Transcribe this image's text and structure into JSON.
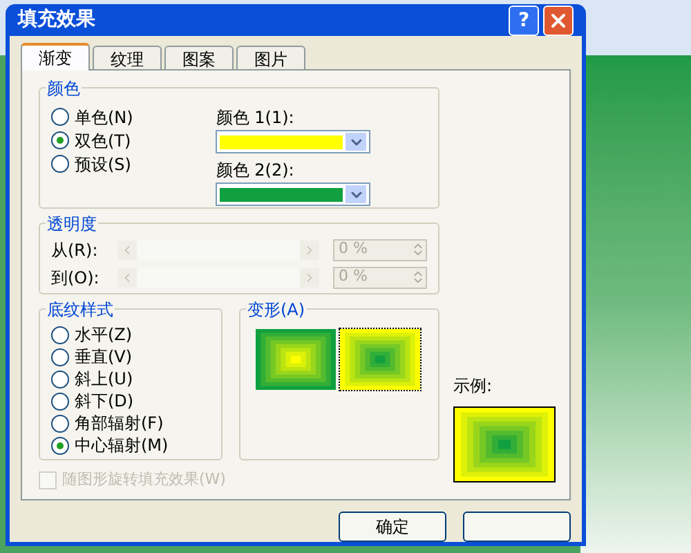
{
  "window": {
    "title": "填充效果",
    "help": "?"
  },
  "tabs": [
    {
      "label": "渐变",
      "selected": true
    },
    {
      "label": "纹理",
      "selected": false
    },
    {
      "label": "图案",
      "selected": false
    },
    {
      "label": "图片",
      "selected": false
    }
  ],
  "colors": {
    "title": "颜色",
    "options": [
      {
        "label": "单色(N)",
        "selected": false
      },
      {
        "label": "双色(T)",
        "selected": true
      },
      {
        "label": "预设(S)",
        "selected": false
      }
    ],
    "pickers": [
      {
        "label": "颜色 1(1):",
        "color": "#ffff00"
      },
      {
        "label": "颜色 2(2):",
        "color": "#10a040"
      }
    ]
  },
  "transparency": {
    "title": "透明度",
    "rows": [
      {
        "label": "从(R):",
        "value": "0 %",
        "disabled": true
      },
      {
        "label": "到(O):",
        "value": "0 %",
        "disabled": true
      }
    ]
  },
  "shading": {
    "title": "底纹样式",
    "options": [
      {
        "label": "水平(Z)",
        "selected": false
      },
      {
        "label": "垂直(V)",
        "selected": false
      },
      {
        "label": "斜上(U)",
        "selected": false
      },
      {
        "label": "斜下(D)",
        "selected": false
      },
      {
        "label": "角部辐射(F)",
        "selected": false
      },
      {
        "label": "中心辐射(M)",
        "selected": true
      }
    ]
  },
  "variants": {
    "title": "变形(A)",
    "items": [
      {
        "selected": false
      },
      {
        "selected": true
      }
    ]
  },
  "sample": {
    "label": "示例:"
  },
  "rotate_checkbox": {
    "label": "随图形旋转填充效果(W)",
    "checked": false,
    "disabled": true
  },
  "buttons": [
    {
      "kind": "text",
      "label": "确定"
    },
    {
      "kind": "blank"
    }
  ]
}
